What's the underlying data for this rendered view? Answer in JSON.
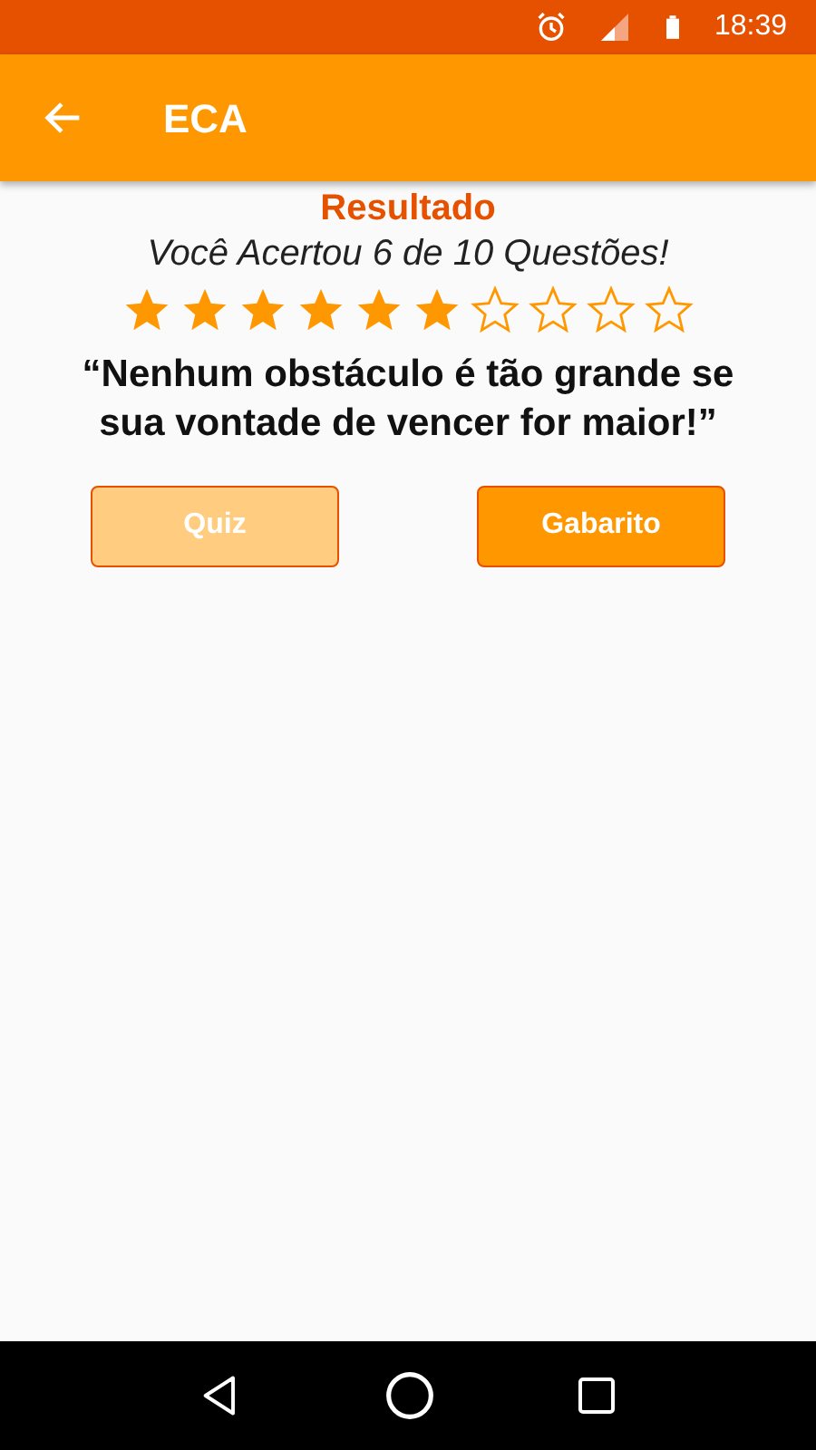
{
  "status_bar": {
    "time": "18:39"
  },
  "app_bar": {
    "title": "ECA"
  },
  "result": {
    "heading": "Resultado",
    "score_text": "Você Acertou 6 de 10 Questões!",
    "stars": 6,
    "quote": "“Nenhum obstáculo é tão grande se sua vontade de vencer for maior!”"
  },
  "buttons": [
    {
      "label": "Quiz",
      "disabled": true
    },
    {
      "label": "Gabarito",
      "disabled": false
    }
  ]
}
